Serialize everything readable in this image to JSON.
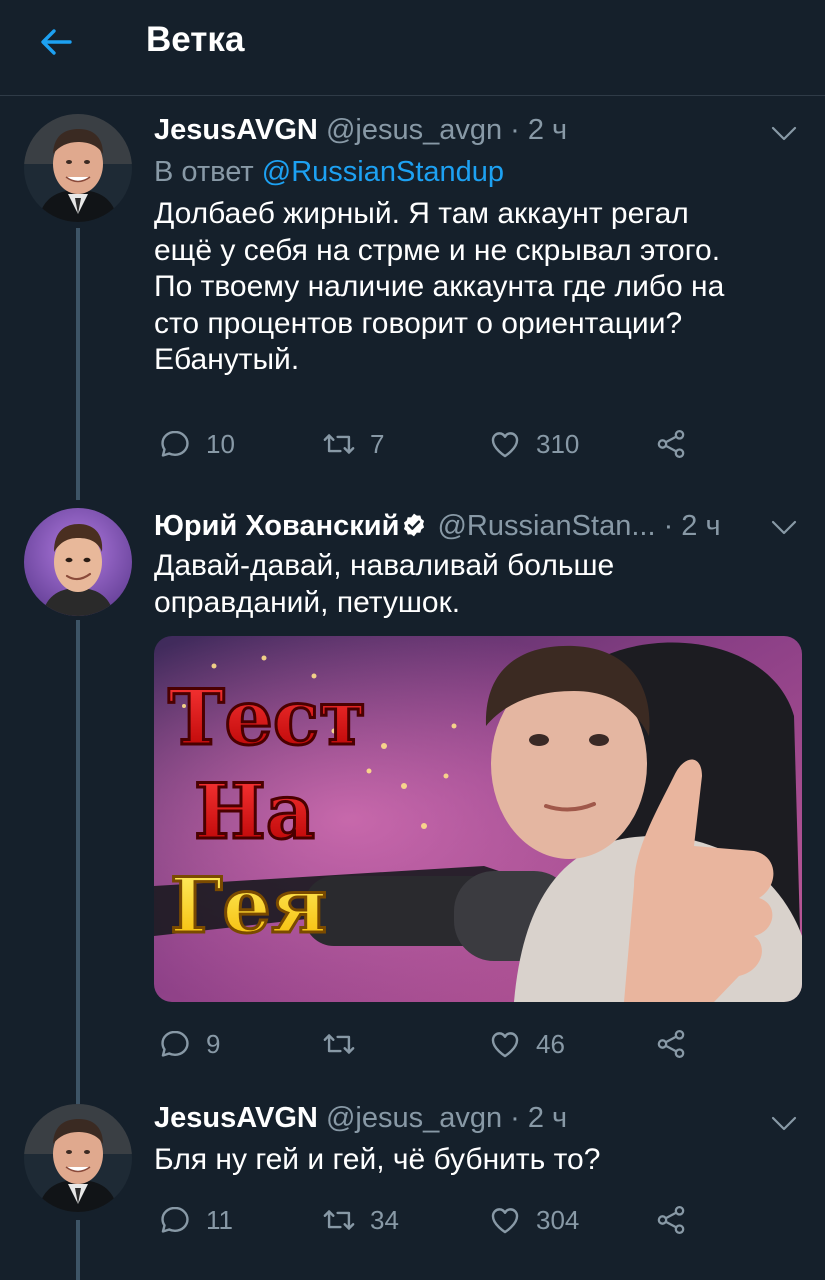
{
  "header": {
    "title": "Ветка"
  },
  "tweets": [
    {
      "name": "JesusAVGN",
      "handle": "@jesus_avgn",
      "time": "· 2 ч",
      "reply_prefix": "В ответ ",
      "reply_mention": "@RussianStandup",
      "text": "Долбаеб жирный. Я там аккаунт регал\nещё у себя на стрме и не скрывал этого.\nПо твоему наличие аккаунта где либо на\nсто процентов говорит о ориентации?\nЕбанутый.",
      "replies": "10",
      "retweets": "7",
      "likes": "310"
    },
    {
      "name": "Юрий Хованский",
      "handle": "@RussianStan...",
      "time": "· 2 ч",
      "text": "Давай-давай, наваливай больше\nоправданий, петушок.",
      "media_title": [
        "Тест",
        "На",
        "Гея"
      ],
      "replies": "9",
      "retweets": "",
      "likes": "46"
    },
    {
      "name": "JesusAVGN",
      "handle": "@jesus_avgn",
      "time": "· 2 ч",
      "text": "Бля ну гей и гей, чё бубнить то?",
      "replies": "11",
      "retweets": "34",
      "likes": "304"
    }
  ],
  "colors": {
    "background": "#15202b",
    "accent": "#1da1f2",
    "secondary_text": "#8899a6",
    "thread_line": "#3d5466"
  },
  "icons": [
    "arrow-left-icon",
    "chevron-down-icon",
    "reply-icon",
    "retweet-icon",
    "like-icon",
    "share-icon",
    "verified-badge-icon"
  ]
}
